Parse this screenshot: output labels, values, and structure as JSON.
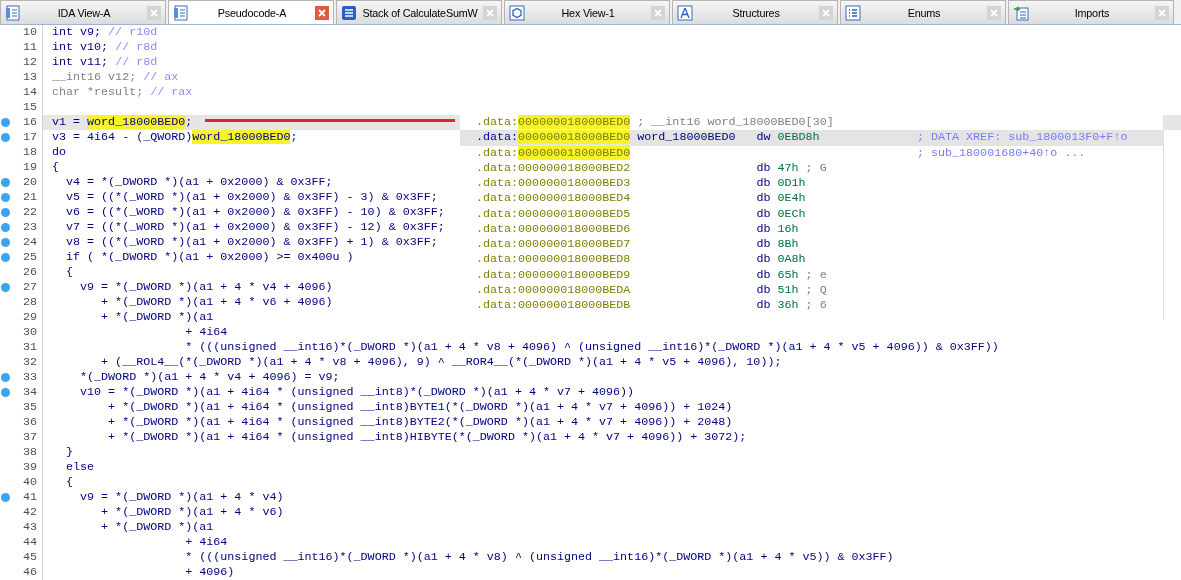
{
  "tabs": [
    {
      "label": "IDA View-A",
      "selected": false
    },
    {
      "label": "Pseudocode-A",
      "selected": true
    },
    {
      "label": "Stack of CalculateSumW",
      "selected": false
    },
    {
      "label": "Hex View-1",
      "selected": false
    },
    {
      "label": "Structures",
      "selected": false
    },
    {
      "label": "Enums",
      "selected": false
    },
    {
      "label": "Imports",
      "selected": false
    }
  ],
  "pseudocode": {
    "lines": [
      {
        "number": "10",
        "breakpoint": false,
        "current": false,
        "dimmed": false,
        "parts": [
          {
            "kind": "code",
            "text": "int v9; "
          },
          {
            "kind": "comment",
            "text": "// r10d"
          }
        ]
      },
      {
        "number": "11",
        "breakpoint": false,
        "current": false,
        "dimmed": false,
        "parts": [
          {
            "kind": "code",
            "text": "int v10; "
          },
          {
            "kind": "comment",
            "text": "// r8d"
          }
        ]
      },
      {
        "number": "12",
        "breakpoint": false,
        "current": false,
        "dimmed": false,
        "parts": [
          {
            "kind": "code",
            "text": "int v11; "
          },
          {
            "kind": "comment",
            "text": "// r8d"
          }
        ]
      },
      {
        "number": "13",
        "breakpoint": false,
        "current": false,
        "dimmed": true,
        "parts": [
          {
            "kind": "code",
            "text": "__int16 v12; "
          },
          {
            "kind": "comment",
            "text": "// ax"
          }
        ]
      },
      {
        "number": "14",
        "breakpoint": false,
        "current": false,
        "dimmed": true,
        "parts": [
          {
            "kind": "code",
            "text": "char *result; "
          },
          {
            "kind": "comment",
            "text": "// rax"
          }
        ]
      },
      {
        "number": "15",
        "breakpoint": false,
        "current": false
      },
      {
        "number": "16",
        "breakpoint": true,
        "current": true,
        "dimmed": false,
        "parts": [
          {
            "kind": "code",
            "text": "v1 = "
          },
          {
            "kind": "highlight",
            "text": "word_18000BED0"
          },
          {
            "kind": "code",
            "text": ";"
          }
        ]
      },
      {
        "number": "17",
        "breakpoint": true,
        "current": false,
        "dimmed": false,
        "parts": [
          {
            "kind": "code",
            "text": "v3 = 4i64 - (_QWORD)"
          },
          {
            "kind": "highlight",
            "text": "word_18000BED0"
          },
          {
            "kind": "code",
            "text": ";"
          }
        ]
      },
      {
        "number": "18",
        "breakpoint": false,
        "current": false,
        "dimmed": false,
        "parts": [
          {
            "kind": "code",
            "text": "do"
          }
        ]
      },
      {
        "number": "19",
        "breakpoint": false,
        "current": false,
        "dimmed": false,
        "parts": [
          {
            "kind": "code",
            "text": "{"
          }
        ]
      },
      {
        "number": "20",
        "breakpoint": true,
        "current": false,
        "dimmed": false,
        "parts": [
          {
            "kind": "code",
            "text": "  v4 = *(_DWORD *)(a1 + 0x2000) & 0x3FF;"
          }
        ]
      },
      {
        "number": "21",
        "breakpoint": true,
        "current": false,
        "dimmed": false,
        "parts": [
          {
            "kind": "code",
            "text": "  v5 = ((*(_WORD *)(a1 + 0x2000) & 0x3FF) - 3) & 0x3FF;"
          }
        ]
      },
      {
        "number": "22",
        "breakpoint": true,
        "current": false,
        "dimmed": false,
        "parts": [
          {
            "kind": "code",
            "text": "  v6 = ((*(_WORD *)(a1 + 0x2000) & 0x3FF) - 10) & 0x3FF;"
          }
        ]
      },
      {
        "number": "23",
        "breakpoint": true,
        "current": false,
        "dimmed": false,
        "parts": [
          {
            "kind": "code",
            "text": "  v7 = ((*(_WORD *)(a1 + 0x2000) & 0x3FF) - 12) & 0x3FF;"
          }
        ]
      },
      {
        "number": "24",
        "breakpoint": true,
        "current": false,
        "dimmed": false,
        "parts": [
          {
            "kind": "code",
            "text": "  v8 = ((*(_WORD *)(a1 + 0x2000) & 0x3FF) + 1) & 0x3FF;"
          }
        ]
      },
      {
        "number": "25",
        "breakpoint": true,
        "current": false,
        "dimmed": false,
        "parts": [
          {
            "kind": "code",
            "text": "  if ( *(_DWORD *)(a1 + 0x2000) >= 0x400u )"
          }
        ]
      },
      {
        "number": "26",
        "breakpoint": false,
        "current": false,
        "dimmed": false,
        "parts": [
          {
            "kind": "code",
            "text": "  {"
          }
        ]
      },
      {
        "number": "27",
        "breakpoint": true,
        "current": false,
        "dimmed": false,
        "parts": [
          {
            "kind": "code",
            "text": "    v9 = *(_DWORD *)(a1 + 4 * v4 + 4096)"
          }
        ]
      },
      {
        "number": "28",
        "breakpoint": false,
        "current": false,
        "dimmed": false,
        "parts": [
          {
            "kind": "code",
            "text": "       + *(_DWORD *)(a1 + 4 * v6 + 4096)"
          }
        ]
      },
      {
        "number": "29",
        "breakpoint": false,
        "current": false,
        "dimmed": false,
        "parts": [
          {
            "kind": "code",
            "text": "       + *(_DWORD *)(a1"
          }
        ]
      },
      {
        "number": "30",
        "breakpoint": false,
        "current": false,
        "dimmed": false,
        "parts": [
          {
            "kind": "code",
            "text": "                   + 4i64"
          }
        ]
      },
      {
        "number": "31",
        "breakpoint": false,
        "current": false,
        "dimmed": false,
        "parts": [
          {
            "kind": "code",
            "text": "                   * (((unsigned __int16)*(_DWORD *)(a1 + 4 * v8 + 4096) ^ (unsigned __int16)*(_DWORD *)(a1 + 4 * v5 + 4096)) & 0x3FF))"
          }
        ]
      },
      {
        "number": "32",
        "breakpoint": false,
        "current": false,
        "dimmed": false,
        "parts": [
          {
            "kind": "code",
            "text": "       + (__ROL4__(*(_DWORD *)(a1 + 4 * v8 + 4096), 9) ^ __ROR4__(*(_DWORD *)(a1 + 4 * v5 + 4096), 10));"
          }
        ]
      },
      {
        "number": "33",
        "breakpoint": true,
        "current": false,
        "dimmed": false,
        "parts": [
          {
            "kind": "code",
            "text": "    *(_DWORD *)(a1 + 4 * v4 + 4096) = v9;"
          }
        ]
      },
      {
        "number": "34",
        "breakpoint": true,
        "current": false,
        "dimmed": false,
        "parts": [
          {
            "kind": "code",
            "text": "    v10 = *(_DWORD *)(a1 + 4i64 * (unsigned __int8)*(_DWORD *)(a1 + 4 * v7 + 4096))"
          }
        ]
      },
      {
        "number": "35",
        "breakpoint": false,
        "current": false,
        "dimmed": false,
        "parts": [
          {
            "kind": "code",
            "text": "        + *(_DWORD *)(a1 + 4i64 * (unsigned __int8)BYTE1(*(_DWORD *)(a1 + 4 * v7 + 4096)) + 1024)"
          }
        ]
      },
      {
        "number": "36",
        "breakpoint": false,
        "current": false,
        "dimmed": false,
        "parts": [
          {
            "kind": "code",
            "text": "        + *(_DWORD *)(a1 + 4i64 * (unsigned __int8)BYTE2(*(_DWORD *)(a1 + 4 * v7 + 4096)) + 2048)"
          }
        ]
      },
      {
        "number": "37",
        "breakpoint": false,
        "current": false,
        "dimmed": false,
        "parts": [
          {
            "kind": "code",
            "text": "        + *(_DWORD *)(a1 + 4i64 * (unsigned __int8)HIBYTE(*(_DWORD *)(a1 + 4 * v7 + 4096)) + 3072);"
          }
        ]
      },
      {
        "number": "38",
        "breakpoint": false,
        "current": false,
        "dimmed": false,
        "parts": [
          {
            "kind": "code",
            "text": "  }"
          }
        ]
      },
      {
        "number": "39",
        "breakpoint": false,
        "current": false,
        "dimmed": false,
        "parts": [
          {
            "kind": "code",
            "text": "  else"
          }
        ]
      },
      {
        "number": "40",
        "breakpoint": false,
        "current": false,
        "dimmed": false,
        "parts": [
          {
            "kind": "code",
            "text": "  {"
          }
        ]
      },
      {
        "number": "41",
        "breakpoint": true,
        "current": false,
        "dimmed": false,
        "parts": [
          {
            "kind": "code",
            "text": "    v9 = *(_DWORD *)(a1 + 4 * v4)"
          }
        ]
      },
      {
        "number": "42",
        "breakpoint": false,
        "current": false,
        "dimmed": false,
        "parts": [
          {
            "kind": "code",
            "text": "       + *(_DWORD *)(a1 + 4 * v6)"
          }
        ]
      },
      {
        "number": "43",
        "breakpoint": false,
        "current": false,
        "dimmed": false,
        "parts": [
          {
            "kind": "code",
            "text": "       + *(_DWORD *)(a1"
          }
        ]
      },
      {
        "number": "44",
        "breakpoint": false,
        "current": false,
        "dimmed": false,
        "parts": [
          {
            "kind": "code",
            "text": "                   + 4i64"
          }
        ]
      },
      {
        "number": "45",
        "breakpoint": false,
        "current": false,
        "dimmed": false,
        "parts": [
          {
            "kind": "code",
            "text": "                   * (((unsigned __int16)*(_DWORD *)(a1 + 4 * v8) ^ (unsigned __int16)*(_DWORD *)(a1 + 4 * v5)) & 0x3FF)"
          }
        ]
      },
      {
        "number": "46",
        "breakpoint": false,
        "current": false,
        "dimmed": false,
        "parts": [
          {
            "kind": "code",
            "text": "                   + 4096)"
          }
        ]
      }
    ]
  },
  "hint": {
    "lines": [
      {
        "segment": ".data:",
        "address": "000000018000BED0",
        "highlighted": true,
        "selected": false,
        "declaration": "; __int16 word_18000BED0[30]"
      },
      {
        "segment": ".data:",
        "address": "000000018000BED0",
        "highlighted": true,
        "selected": true,
        "label": "word_18000BED0",
        "op": "dw",
        "operand": "0EBD8h",
        "xref": "; DATA XREF: sub_1800013F0+F↑o"
      },
      {
        "segment": ".data:",
        "address": "000000018000BED0",
        "highlighted": true,
        "selected": false,
        "xref": "; sub_180001680+40↑o ..."
      },
      {
        "segment": ".data:",
        "address": "000000018000BED2",
        "highlighted": false,
        "selected": false,
        "op": "db",
        "operand": "47h",
        "comment": "; G"
      },
      {
        "segment": ".data:",
        "address": "000000018000BED3",
        "highlighted": false,
        "selected": false,
        "op": "db",
        "operand": "0D1h"
      },
      {
        "segment": ".data:",
        "address": "000000018000BED4",
        "highlighted": false,
        "selected": false,
        "op": "db",
        "operand": "0E4h"
      },
      {
        "segment": ".data:",
        "address": "000000018000BED5",
        "highlighted": false,
        "selected": false,
        "op": "db",
        "operand": "0ECh"
      },
      {
        "segment": ".data:",
        "address": "000000018000BED6",
        "highlighted": false,
        "selected": false,
        "op": "db",
        "operand": "16h"
      },
      {
        "segment": ".data:",
        "address": "000000018000BED7",
        "highlighted": false,
        "selected": false,
        "op": "db",
        "operand": "8Bh"
      },
      {
        "segment": ".data:",
        "address": "000000018000BED8",
        "highlighted": false,
        "selected": false,
        "op": "db",
        "operand": "0A8h"
      },
      {
        "segment": ".data:",
        "address": "000000018000BED9",
        "highlighted": false,
        "selected": false,
        "op": "db",
        "operand": "65h",
        "comment": "; e"
      },
      {
        "segment": ".data:",
        "address": "000000018000BEDA",
        "highlighted": false,
        "selected": false,
        "op": "db",
        "operand": "51h",
        "comment": "; Q"
      },
      {
        "segment": ".data:",
        "address": "000000018000BEDB",
        "highlighted": false,
        "selected": false,
        "op": "db",
        "operand": "36h",
        "comment": "; 6"
      }
    ]
  }
}
